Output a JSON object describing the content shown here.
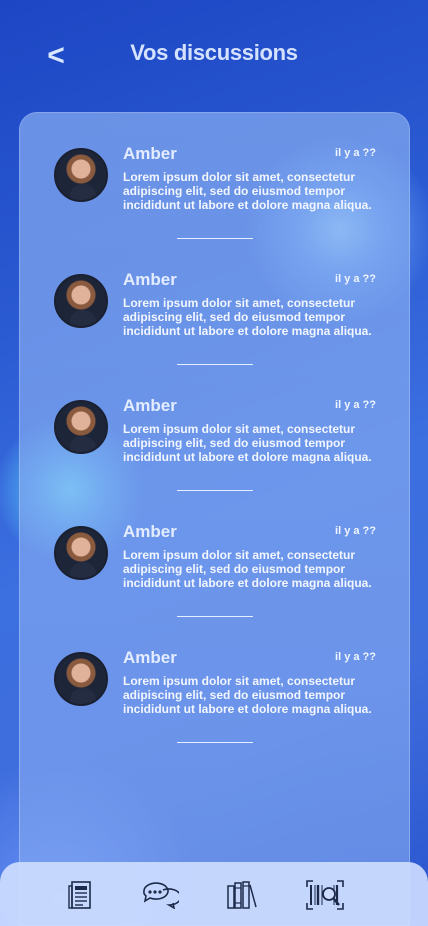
{
  "header": {
    "back_label": "<",
    "title": "Vos discussions"
  },
  "conversations": [
    {
      "name": "Amber",
      "time": "il y a ??",
      "message": "Lorem ipsum dolor sit amet, consectetur adipiscing elit, sed do eiusmod tempor incididunt ut labore et dolore magna aliqua."
    },
    {
      "name": "Amber",
      "time": "il y a ??",
      "message": "Lorem ipsum dolor sit amet, consectetur adipiscing elit, sed do eiusmod tempor incididunt ut labore et dolore magna aliqua."
    },
    {
      "name": "Amber",
      "time": "il y a ??",
      "message": "Lorem ipsum dolor sit amet, consectetur adipiscing elit, sed do eiusmod tempor incididunt ut labore et dolore magna aliqua."
    },
    {
      "name": "Amber",
      "time": "il y a ??",
      "message": "Lorem ipsum dolor sit amet, consectetur adipiscing elit, sed do eiusmod tempor incididunt ut labore et dolore magna aliqua."
    },
    {
      "name": "Amber",
      "time": "il y a ??",
      "message": "Lorem ipsum dolor sit amet, consectetur adipiscing elit, sed do eiusmod tempor incididunt ut labore et dolore magna aliqua."
    }
  ],
  "bottom_nav": [
    {
      "icon": "newspaper-icon"
    },
    {
      "icon": "chat-bubbles-icon"
    },
    {
      "icon": "books-icon"
    },
    {
      "icon": "barcode-scan-icon"
    }
  ],
  "colors": {
    "accent": "#2f5fd0",
    "card": "#96b9f5",
    "nav": "#cddcff"
  }
}
